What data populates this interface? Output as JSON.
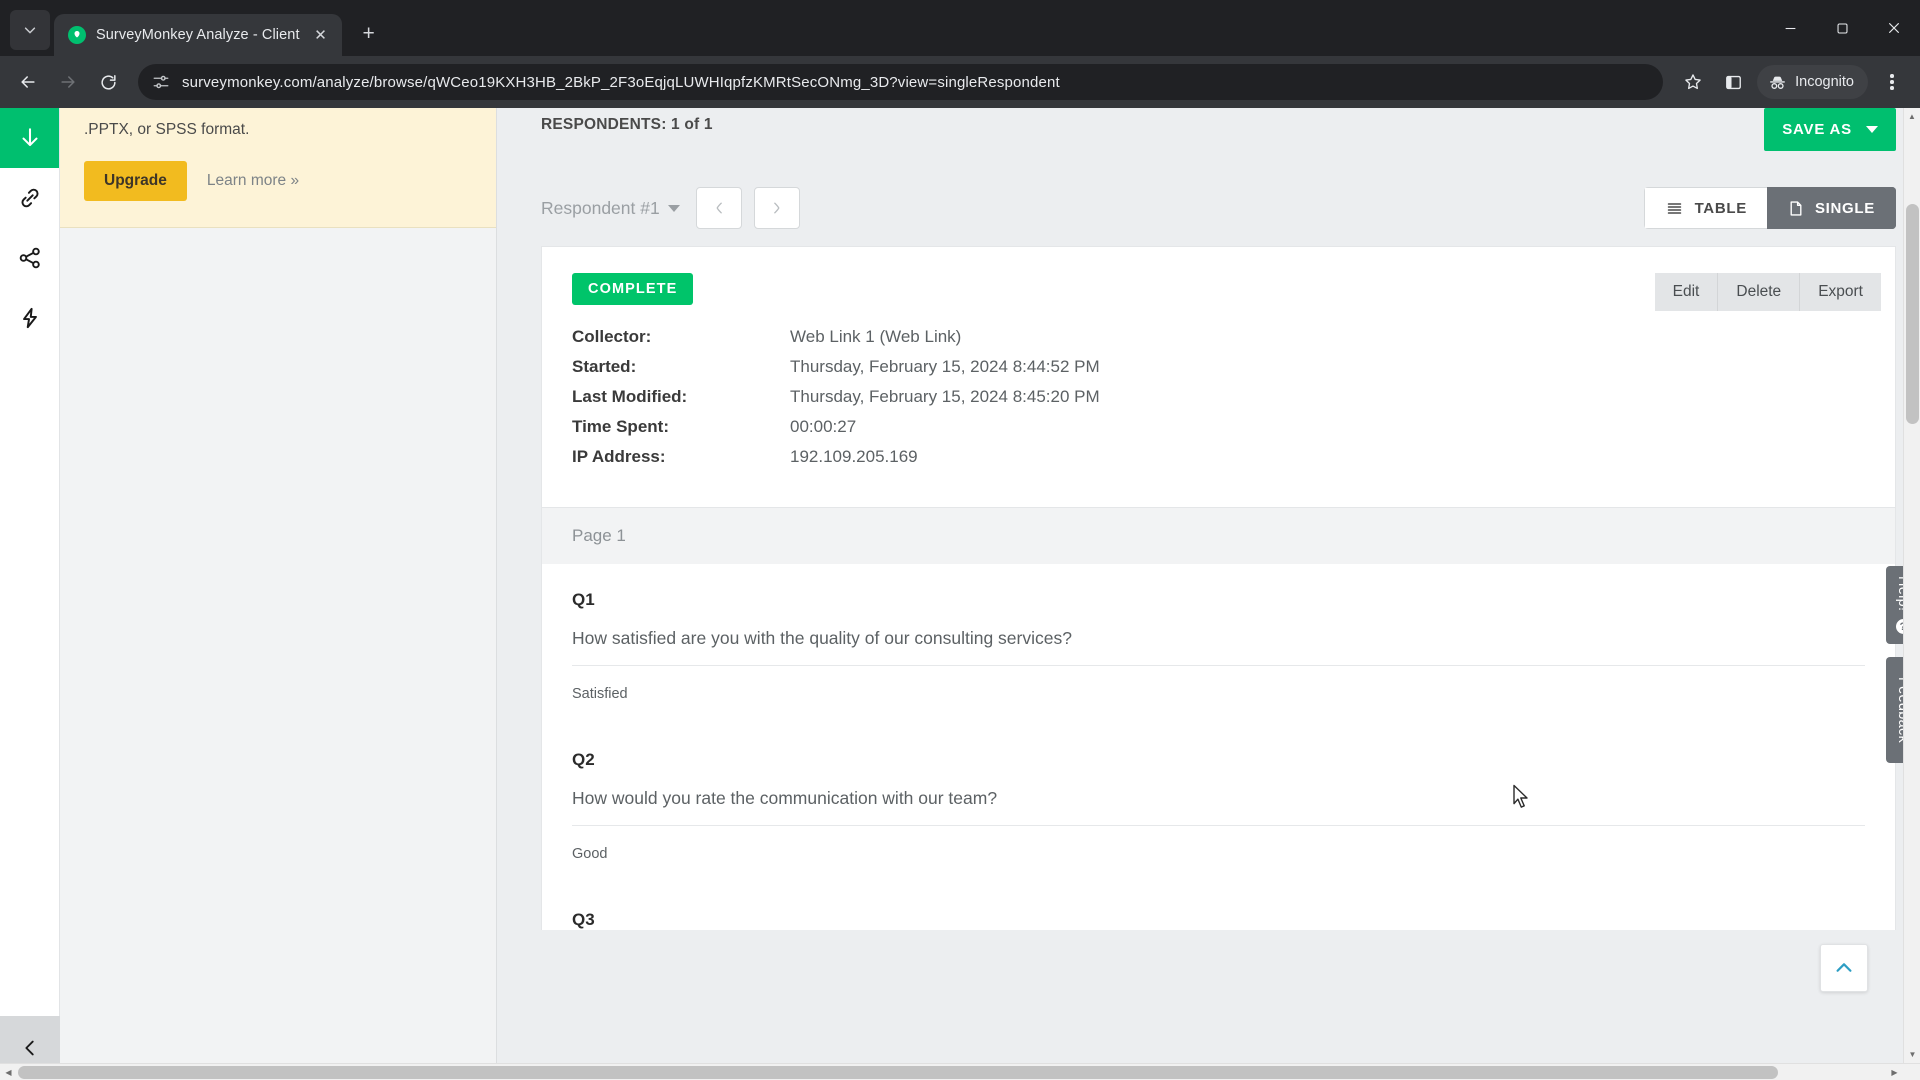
{
  "browser": {
    "tab": {
      "title": "SurveyMonkey Analyze - Client",
      "favicon_icon": "surveymonkey-logo-icon",
      "close_icon": "close-icon"
    },
    "tab_list_icon": "chevron-down-icon",
    "new_tab_icon": "plus-icon",
    "window": {
      "minimize": "minimize-icon",
      "maximize": "maximize-icon",
      "close": "close-icon"
    },
    "nav": {
      "back_icon": "back-arrow-icon",
      "forward_icon": "forward-arrow-icon",
      "reload_icon": "reload-icon"
    },
    "omnibox": {
      "site_settings_icon": "tune-icon",
      "url": "surveymonkey.com/analyze/browse/qWCeo19KXH3HB_2BkP_2F3oEqjqLUWHIqpfzKMRtSecONmg_3D?view=singleRespondent"
    },
    "bookmark_icon": "star-icon",
    "sidepanel_icon": "side-panel-icon",
    "incognito_label": "Incognito",
    "incognito_icon": "incognito-hat-icon",
    "menu_icon": "three-dot-menu-icon"
  },
  "rail": {
    "items": [
      {
        "name": "export",
        "icon": "download-arrow-icon",
        "active": true
      },
      {
        "name": "share-link",
        "icon": "link-icon",
        "active": false
      },
      {
        "name": "share",
        "icon": "share-nodes-icon",
        "active": false
      },
      {
        "name": "integrations",
        "icon": "lightning-bolt-icon",
        "active": false
      }
    ],
    "collapse_icon": "chevron-left-icon"
  },
  "promo": {
    "text": ".PPTX, or SPSS format.",
    "upgrade_label": "Upgrade",
    "learn_more_label": "Learn more »"
  },
  "header": {
    "respondents_count": "RESPONDENTS: 1 of 1",
    "save_as_label": "SAVE AS",
    "save_as_caret_icon": "caret-down-icon"
  },
  "toolrow": {
    "respondent_selected": "Respondent #1",
    "respondent_caret_icon": "caret-down-icon",
    "prev_icon": "left-triangle-icon",
    "next_icon": "right-triangle-icon",
    "view_table_label": "TABLE",
    "view_table_icon": "list-lines-icon",
    "view_single_label": "SINGLE",
    "view_single_icon": "single-page-icon"
  },
  "respondent": {
    "status_badge": "COMPLETE",
    "actions": [
      {
        "label": "Edit",
        "name": "edit-button"
      },
      {
        "label": "Delete",
        "name": "delete-button"
      },
      {
        "label": "Export",
        "name": "export-button"
      }
    ],
    "fields": [
      {
        "label": "Collector:",
        "value": "Web Link 1 (Web Link)"
      },
      {
        "label": "Started:",
        "value": "Thursday, February 15, 2024 8:44:52 PM"
      },
      {
        "label": "Last Modified:",
        "value": "Thursday, February 15, 2024 8:45:20 PM"
      },
      {
        "label": "Time Spent:",
        "value": "00:00:27"
      },
      {
        "label": "IP Address:",
        "value": "192.109.205.169"
      }
    ]
  },
  "survey": {
    "page_label": "Page 1",
    "questions": [
      {
        "number": "Q1",
        "text": "How satisfied are you with the quality of our consulting services?",
        "answer": "Satisfied"
      },
      {
        "number": "Q2",
        "text": "How would you rate the communication with our team?",
        "answer": "Good"
      },
      {
        "number": "Q3",
        "text": "",
        "answer": ""
      }
    ]
  },
  "sidetabs": {
    "help_label": "Help!",
    "help_icon": "question-mark-icon",
    "feedback_label": "Feedback"
  },
  "scroll_top_icon": "chevron-up-icon",
  "colors": {
    "brand_green": "#00bf6f",
    "complete_green": "#00c46a",
    "upgrade_yellow": "#f2bb1f",
    "promo_bg": "#fdf3d7",
    "toggle_active": "#6b7076"
  }
}
